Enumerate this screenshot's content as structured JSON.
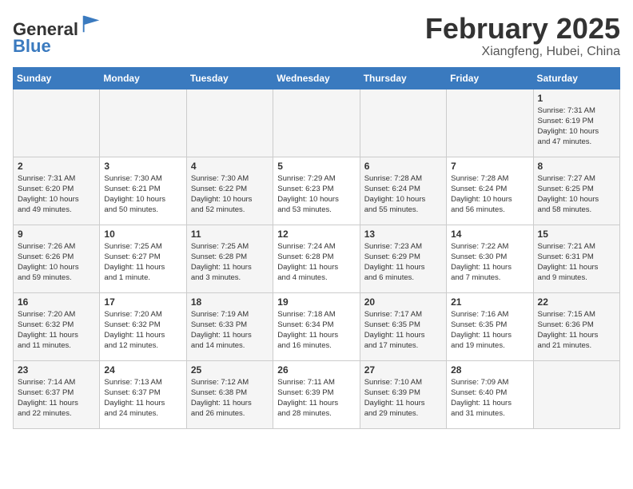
{
  "header": {
    "logo_line1": "General",
    "logo_line2": "Blue",
    "title": "February 2025",
    "subtitle": "Xiangfeng, Hubei, China"
  },
  "days_of_week": [
    "Sunday",
    "Monday",
    "Tuesday",
    "Wednesday",
    "Thursday",
    "Friday",
    "Saturday"
  ],
  "weeks": [
    [
      {
        "day": "",
        "info": ""
      },
      {
        "day": "",
        "info": ""
      },
      {
        "day": "",
        "info": ""
      },
      {
        "day": "",
        "info": ""
      },
      {
        "day": "",
        "info": ""
      },
      {
        "day": "",
        "info": ""
      },
      {
        "day": "1",
        "info": "Sunrise: 7:31 AM\nSunset: 6:19 PM\nDaylight: 10 hours\nand 47 minutes."
      }
    ],
    [
      {
        "day": "2",
        "info": "Sunrise: 7:31 AM\nSunset: 6:20 PM\nDaylight: 10 hours\nand 49 minutes."
      },
      {
        "day": "3",
        "info": "Sunrise: 7:30 AM\nSunset: 6:21 PM\nDaylight: 10 hours\nand 50 minutes."
      },
      {
        "day": "4",
        "info": "Sunrise: 7:30 AM\nSunset: 6:22 PM\nDaylight: 10 hours\nand 52 minutes."
      },
      {
        "day": "5",
        "info": "Sunrise: 7:29 AM\nSunset: 6:23 PM\nDaylight: 10 hours\nand 53 minutes."
      },
      {
        "day": "6",
        "info": "Sunrise: 7:28 AM\nSunset: 6:24 PM\nDaylight: 10 hours\nand 55 minutes."
      },
      {
        "day": "7",
        "info": "Sunrise: 7:28 AM\nSunset: 6:24 PM\nDaylight: 10 hours\nand 56 minutes."
      },
      {
        "day": "8",
        "info": "Sunrise: 7:27 AM\nSunset: 6:25 PM\nDaylight: 10 hours\nand 58 minutes."
      }
    ],
    [
      {
        "day": "9",
        "info": "Sunrise: 7:26 AM\nSunset: 6:26 PM\nDaylight: 10 hours\nand 59 minutes."
      },
      {
        "day": "10",
        "info": "Sunrise: 7:25 AM\nSunset: 6:27 PM\nDaylight: 11 hours\nand 1 minute."
      },
      {
        "day": "11",
        "info": "Sunrise: 7:25 AM\nSunset: 6:28 PM\nDaylight: 11 hours\nand 3 minutes."
      },
      {
        "day": "12",
        "info": "Sunrise: 7:24 AM\nSunset: 6:28 PM\nDaylight: 11 hours\nand 4 minutes."
      },
      {
        "day": "13",
        "info": "Sunrise: 7:23 AM\nSunset: 6:29 PM\nDaylight: 11 hours\nand 6 minutes."
      },
      {
        "day": "14",
        "info": "Sunrise: 7:22 AM\nSunset: 6:30 PM\nDaylight: 11 hours\nand 7 minutes."
      },
      {
        "day": "15",
        "info": "Sunrise: 7:21 AM\nSunset: 6:31 PM\nDaylight: 11 hours\nand 9 minutes."
      }
    ],
    [
      {
        "day": "16",
        "info": "Sunrise: 7:20 AM\nSunset: 6:32 PM\nDaylight: 11 hours\nand 11 minutes."
      },
      {
        "day": "17",
        "info": "Sunrise: 7:20 AM\nSunset: 6:32 PM\nDaylight: 11 hours\nand 12 minutes."
      },
      {
        "day": "18",
        "info": "Sunrise: 7:19 AM\nSunset: 6:33 PM\nDaylight: 11 hours\nand 14 minutes."
      },
      {
        "day": "19",
        "info": "Sunrise: 7:18 AM\nSunset: 6:34 PM\nDaylight: 11 hours\nand 16 minutes."
      },
      {
        "day": "20",
        "info": "Sunrise: 7:17 AM\nSunset: 6:35 PM\nDaylight: 11 hours\nand 17 minutes."
      },
      {
        "day": "21",
        "info": "Sunrise: 7:16 AM\nSunset: 6:35 PM\nDaylight: 11 hours\nand 19 minutes."
      },
      {
        "day": "22",
        "info": "Sunrise: 7:15 AM\nSunset: 6:36 PM\nDaylight: 11 hours\nand 21 minutes."
      }
    ],
    [
      {
        "day": "23",
        "info": "Sunrise: 7:14 AM\nSunset: 6:37 PM\nDaylight: 11 hours\nand 22 minutes."
      },
      {
        "day": "24",
        "info": "Sunrise: 7:13 AM\nSunset: 6:37 PM\nDaylight: 11 hours\nand 24 minutes."
      },
      {
        "day": "25",
        "info": "Sunrise: 7:12 AM\nSunset: 6:38 PM\nDaylight: 11 hours\nand 26 minutes."
      },
      {
        "day": "26",
        "info": "Sunrise: 7:11 AM\nSunset: 6:39 PM\nDaylight: 11 hours\nand 28 minutes."
      },
      {
        "day": "27",
        "info": "Sunrise: 7:10 AM\nSunset: 6:39 PM\nDaylight: 11 hours\nand 29 minutes."
      },
      {
        "day": "28",
        "info": "Sunrise: 7:09 AM\nSunset: 6:40 PM\nDaylight: 11 hours\nand 31 minutes."
      },
      {
        "day": "",
        "info": ""
      }
    ]
  ]
}
